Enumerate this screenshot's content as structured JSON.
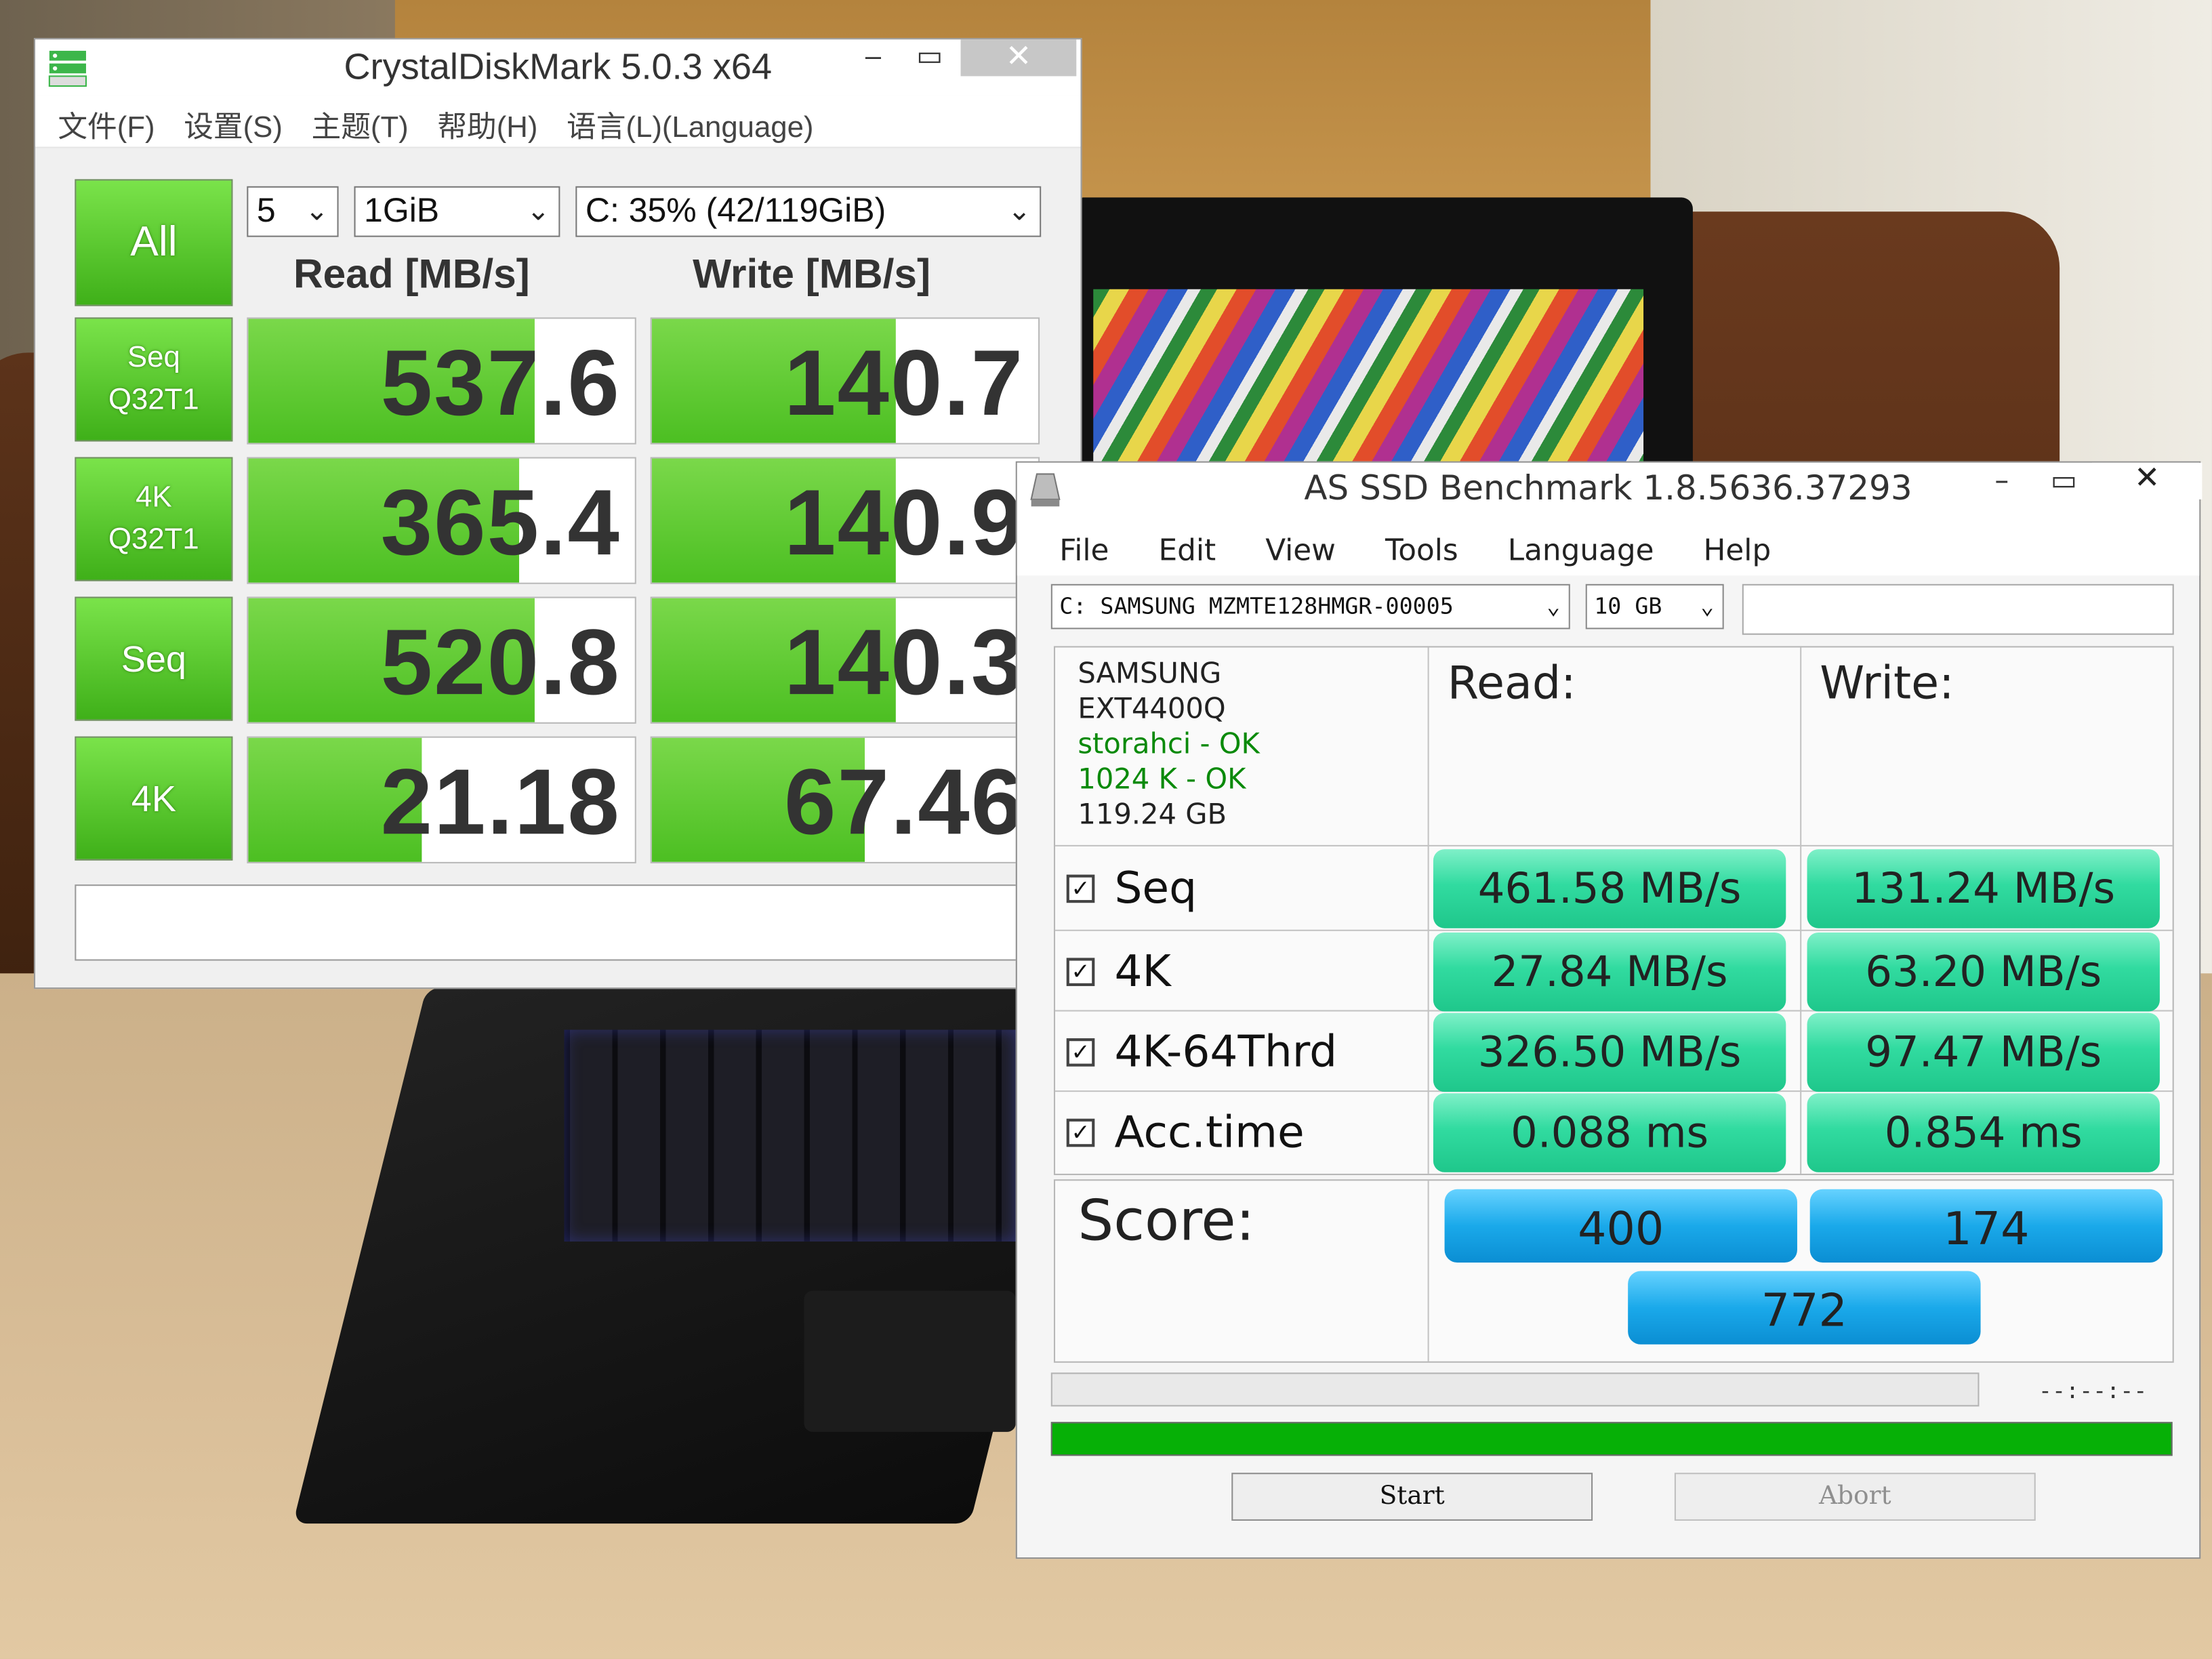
{
  "cdm": {
    "title": "CrystalDiskMark 5.0.3 x64",
    "window_controls": {
      "minimize": "–",
      "maximize": "▭",
      "close": "✕"
    },
    "menu": [
      "文件(F)",
      "设置(S)",
      "主题(T)",
      "帮助(H)",
      "语言(L)(Language)"
    ],
    "all_button": "All",
    "count_select": "5",
    "size_select": "1GiB",
    "drive_select": "C: 35% (42/119GiB)",
    "read_header": "Read [MB/s]",
    "write_header": "Write [MB/s]",
    "rows": [
      {
        "l1": "Seq",
        "l2": "Q32T1",
        "read": "537.6",
        "write": "140.7",
        "read_fill": 0.74,
        "write_fill": 0.63
      },
      {
        "l1": "4K",
        "l2": "Q32T1",
        "read": "365.4",
        "write": "140.9",
        "read_fill": 0.7,
        "write_fill": 0.63
      },
      {
        "l1": "Seq",
        "l2": "",
        "read": "520.8",
        "write": "140.3",
        "read_fill": 0.74,
        "write_fill": 0.63
      },
      {
        "l1": "4K",
        "l2": "",
        "read": "21.18",
        "write": "67.46",
        "read_fill": 0.45,
        "write_fill": 0.55
      }
    ],
    "status_text": ""
  },
  "asssd": {
    "title": "AS SSD Benchmark 1.8.5636.37293",
    "window_controls": {
      "minimize": "–",
      "maximize": "▭",
      "close": "✕"
    },
    "menu": [
      "File",
      "Edit",
      "View",
      "Tools",
      "Language",
      "Help"
    ],
    "drive_select": "C: SAMSUNG MZMTE128HMGR-00005",
    "size_select": "10 GB",
    "info": {
      "brand": "SAMSUNG",
      "model": "EXT4400Q",
      "driver": "storahci - OK",
      "align": "1024 K - OK",
      "capacity": "119.24 GB"
    },
    "read_header": "Read:",
    "write_header": "Write:",
    "rows": [
      {
        "label": "Seq",
        "checked": "✓",
        "read": "461.58 MB/s",
        "write": "131.24 MB/s"
      },
      {
        "label": "4K",
        "checked": "✓",
        "read": "27.84 MB/s",
        "write": "63.20 MB/s"
      },
      {
        "label": "4K-64Thrd",
        "checked": "✓",
        "read": "326.50 MB/s",
        "write": "97.47 MB/s"
      },
      {
        "label": "Acc.time",
        "checked": "✓",
        "read": "0.088 ms",
        "write": "0.854 ms"
      }
    ],
    "score_label": "Score:",
    "score_read": "400",
    "score_write": "174",
    "score_total": "772",
    "timer": "--:--:--",
    "progress_top": 0,
    "progress_bottom": 1,
    "start_button": "Start",
    "abort_button": "Abort"
  },
  "colors": {
    "cdm_green": "#4cbf22",
    "asssd_pill": "#31dba0",
    "asssd_score": "#1aa9ea",
    "progress_green": "#06b006"
  }
}
